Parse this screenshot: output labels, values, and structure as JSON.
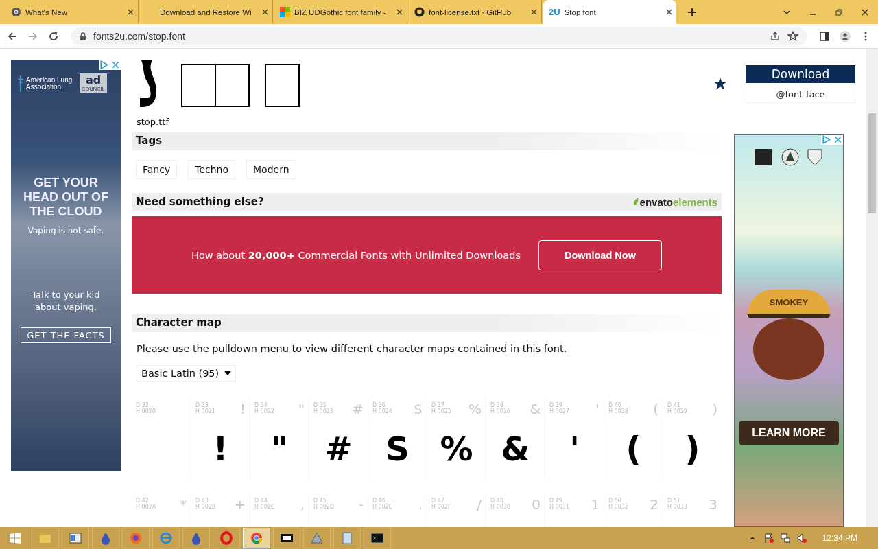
{
  "browser": {
    "tabs": [
      {
        "title": "What's New",
        "kind": "chrome",
        "selected": false
      },
      {
        "title": "Download and Restore Wi",
        "kind": "blank",
        "selected": false
      },
      {
        "title": "BIZ UDGothic font family -",
        "kind": "windows",
        "selected": false
      },
      {
        "title": "font-license.txt · GitHub",
        "kind": "github",
        "selected": false
      },
      {
        "title": "Stop font",
        "kind": "text",
        "icon_text": "2U",
        "selected": true
      }
    ],
    "url": "fonts2u.com/stop.font"
  },
  "left_ad": {
    "org": "American Lung Association.",
    "badge": "ad",
    "badge_sub": "COUNCIL",
    "headline": "GET YOUR HEAD OUT OF THE CLOUD",
    "subline": "Vaping is not safe.",
    "body": "Talk to your kid about vaping.",
    "button": "GET THE FACTS"
  },
  "font_file": "stop.ttf",
  "tags": {
    "title": "Tags",
    "items": [
      "Fancy",
      "Techno",
      "Modern"
    ]
  },
  "promo": {
    "title": "Need something else?",
    "brand": "envato",
    "brand_suffix": "elements",
    "text": "How about **20,000+** Commercial Fonts with Unlimited Downloads",
    "button": "Download Now"
  },
  "character_map": {
    "title": "Character map",
    "description": "Please use the pulldown menu to view different character maps contained in this font.",
    "dropdown": "Basic Latin (95)",
    "cells": [
      {
        "dec": "D 32",
        "hex": "H 0020"
      },
      {
        "dec": "D 33",
        "hex": "H 0021",
        "char": "!",
        "glyph": "!"
      },
      {
        "dec": "D 34",
        "hex": "H 0022",
        "char": "\"",
        "glyph": "\""
      },
      {
        "dec": "D 35",
        "hex": "H 0023",
        "char": "#",
        "glyph": "#"
      },
      {
        "dec": "D 36",
        "hex": "H 0024",
        "char": "$",
        "glyph": "S"
      },
      {
        "dec": "D 37",
        "hex": "H 0025",
        "char": "%",
        "glyph": "%"
      },
      {
        "dec": "D 38",
        "hex": "H 0026",
        "char": "&",
        "glyph": "&"
      },
      {
        "dec": "D 39",
        "hex": "H 0027",
        "char": "'",
        "glyph": "'"
      },
      {
        "dec": "D 40",
        "hex": "H 0028",
        "char": "(",
        "glyph": "("
      },
      {
        "dec": "D 41",
        "hex": "H 0029",
        "char": ")",
        "glyph": ")"
      },
      {
        "dec": "D 42",
        "hex": "H 002A",
        "char": "*"
      },
      {
        "dec": "D 43",
        "hex": "H 002B",
        "char": "+"
      },
      {
        "dec": "D 44",
        "hex": "H 002C",
        "char": ","
      },
      {
        "dec": "D 45",
        "hex": "H 002D",
        "char": "-"
      },
      {
        "dec": "D 46",
        "hex": "H 002E",
        "char": "."
      },
      {
        "dec": "D 47",
        "hex": "H 002F",
        "char": "/"
      },
      {
        "dec": "D 48",
        "hex": "H 0030",
        "char": "0"
      },
      {
        "dec": "D 49",
        "hex": "H 0031",
        "char": "1"
      },
      {
        "dec": "D 50",
        "hex": "H 0032",
        "char": "2"
      },
      {
        "dec": "D 51",
        "hex": "H 0033",
        "char": "3"
      }
    ]
  },
  "sidebar": {
    "download": "Download",
    "font_face": "@font-face"
  },
  "right_ad": {
    "hat": "SMOKEY",
    "button": "LEARN MORE"
  },
  "taskbar": {
    "apps": [
      {
        "kind": "folder",
        "selected": false
      },
      {
        "kind": "window",
        "selected": false
      },
      {
        "kind": "drop",
        "selected": false
      },
      {
        "kind": "firefox",
        "selected": false
      },
      {
        "kind": "ie",
        "selected": false
      },
      {
        "kind": "drop",
        "selected": false
      },
      {
        "kind": "opera",
        "selected": false
      },
      {
        "kind": "chrome",
        "selected": true
      },
      {
        "kind": "zip",
        "selected": false
      },
      {
        "kind": "triangle",
        "selected": false
      },
      {
        "kind": "notepad",
        "selected": false
      },
      {
        "kind": "console",
        "selected": false
      }
    ],
    "clock": "12:34 PM"
  }
}
